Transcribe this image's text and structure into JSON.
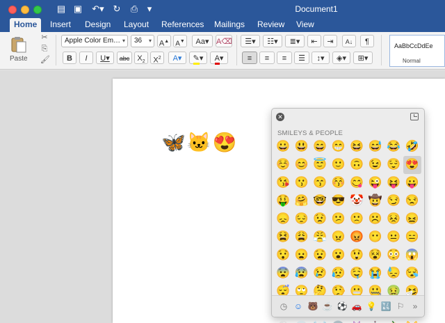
{
  "window": {
    "title": "Document1"
  },
  "tabs": [
    "Home",
    "Insert",
    "Design",
    "Layout",
    "References",
    "Mailings",
    "Review",
    "View"
  ],
  "active_tab": "Home",
  "ribbon": {
    "paste_label": "Paste",
    "font_name": "Apple Color Em…",
    "font_size": "36",
    "styles_sample": "AaBbCcDdEe",
    "styles_label": "Normal"
  },
  "document": {
    "text": "🦋🐱😍"
  },
  "emoji_viewer": {
    "heading": "SMILEYS & PEOPLE",
    "emojis": [
      "😀",
      "😃",
      "😄",
      "😁",
      "😆",
      "😅",
      "😂",
      "🤣",
      "☺️",
      "😊",
      "😇",
      "🙂",
      "🙃",
      "😉",
      "😌",
      "😍",
      "😘",
      "😗",
      "😙",
      "😚",
      "😋",
      "😜",
      "😝",
      "😛",
      "🤑",
      "🤗",
      "🤓",
      "😎",
      "🤡",
      "🤠",
      "😏",
      "😒",
      "😞",
      "😔",
      "😟",
      "😕",
      "🙁",
      "☹️",
      "😣",
      "😖",
      "😫",
      "😩",
      "😤",
      "😠",
      "😡",
      "😶",
      "😐",
      "😑",
      "😯",
      "😦",
      "😧",
      "😮",
      "😲",
      "😵",
      "😳",
      "😱",
      "😨",
      "😰",
      "😢",
      "😥",
      "🤤",
      "😭",
      "😓",
      "😪",
      "😴",
      "🙄",
      "🤔",
      "🤥",
      "😬",
      "🤐",
      "🤢",
      "🤧",
      "😷",
      "🤒",
      "🤕",
      "😈",
      "👿",
      "👹",
      "👺",
      "💩",
      "👻",
      "💀",
      "☠️",
      "👽",
      "👾",
      "🤖",
      "🎃",
      "😺"
    ],
    "selected_index": 15,
    "categories": [
      "clock-icon",
      "smiley-icon",
      "animal-icon",
      "food-icon",
      "soccer-icon",
      "car-icon",
      "bulb-icon",
      "symbols-icon",
      "flag-icon",
      "more-icon"
    ],
    "category_glyphs": [
      "◷",
      "☺",
      "🐻",
      "☕",
      "⚽",
      "🚗",
      "💡",
      "🔣",
      "⚐",
      "»"
    ]
  }
}
